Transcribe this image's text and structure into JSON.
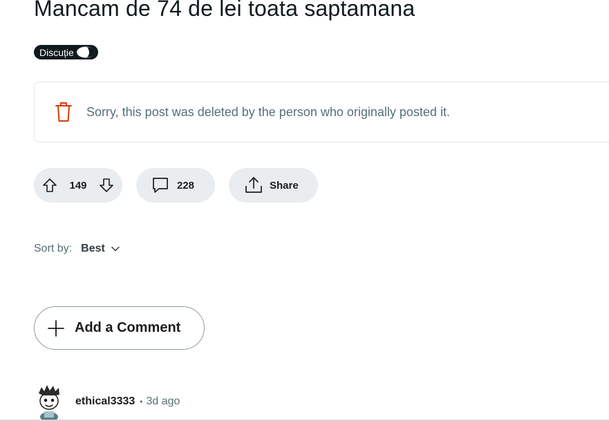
{
  "post": {
    "title": "Mancam de 74 de lei toata saptamana",
    "flair": "Discuție",
    "deleted_message": "Sorry, this post was deleted by the person who originally posted it."
  },
  "actions": {
    "vote_count": "149",
    "comment_count": "228",
    "share_label": "Share"
  },
  "sort": {
    "label": "Sort by:",
    "value": "Best"
  },
  "add_comment": {
    "label": "Add a Comment"
  },
  "comment": {
    "username": "ethical3333",
    "separator": "•",
    "time": "3d ago"
  },
  "icons": {
    "trash": "trash-icon",
    "upvote": "upvote-arrow-icon",
    "downvote": "downvote-arrow-icon",
    "comment": "speech-bubble-icon",
    "share": "share-upload-icon",
    "chevron": "chevron-down-icon",
    "plus": "plus-icon"
  },
  "colors": {
    "deleted_icon": "#d93a00",
    "pill_background": "#eaedef",
    "flair_background": "#0f1a1c"
  }
}
